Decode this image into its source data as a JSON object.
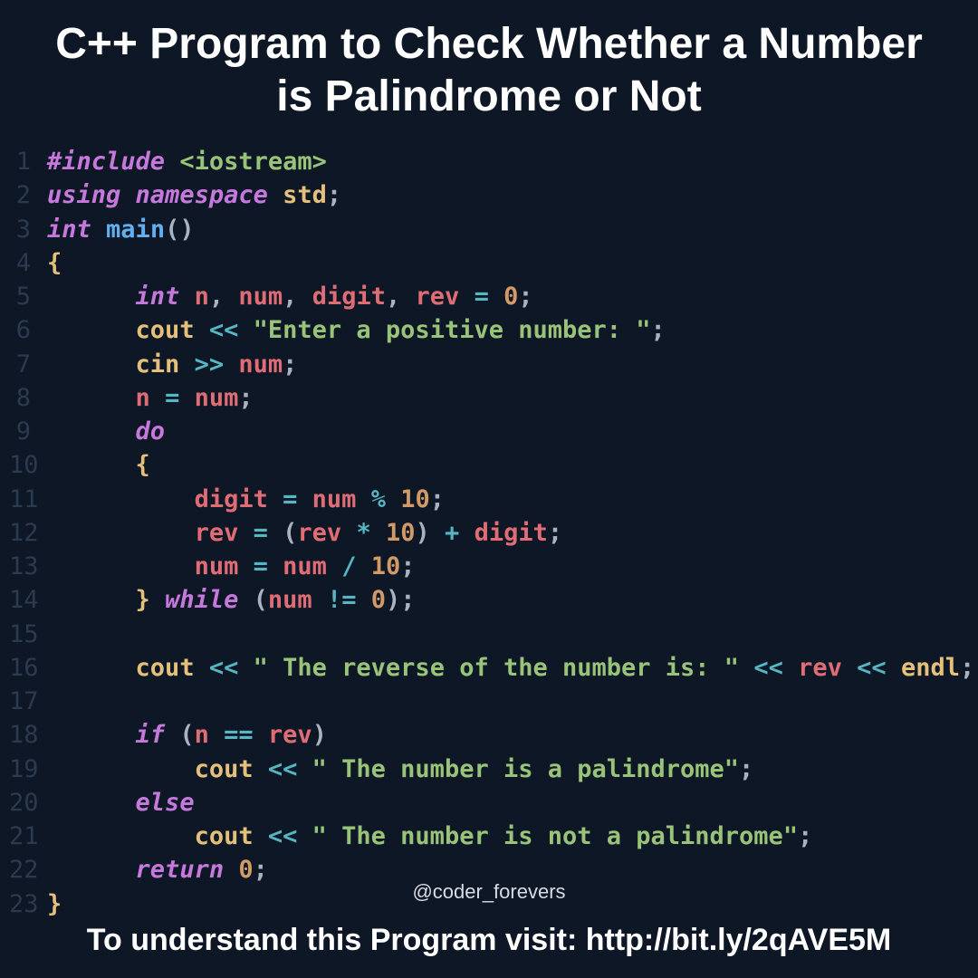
{
  "title": "C++ Program to Check Whether a Number is Palindrome or Not",
  "lines": {
    "l1_pre": "#include",
    "l1_inc": "<iostream>",
    "l2_using": "using",
    "l2_ns": "namespace",
    "l2_std": "std",
    "l3_int": "int",
    "l3_main": "main",
    "l4_brace": "{",
    "l5_int": "int",
    "l5_n": "n",
    "l5_num": "num",
    "l5_digit": "digit",
    "l5_rev": "rev",
    "l5_zero": "0",
    "l6_cout": "cout",
    "l6_str": "\"Enter a positive number: \"",
    "l7_cin": "cin",
    "l7_num": "num",
    "l8_n": "n",
    "l8_num": "num",
    "l9_do": "do",
    "l10_brace": "{",
    "l11_digit": "digit",
    "l11_num": "num",
    "l11_ten": "10",
    "l12_rev": "rev",
    "l12_rev2": "rev",
    "l12_ten": "10",
    "l12_digit": "digit",
    "l13_num": "num",
    "l13_num2": "num",
    "l13_ten": "10",
    "l14_brace": "}",
    "l14_while": "while",
    "l14_num": "num",
    "l14_zero": "0",
    "l16_cout": "cout",
    "l16_str": "\" The reverse of the number is: \"",
    "l16_rev": "rev",
    "l16_endl": "endl",
    "l18_if": "if",
    "l18_n": "n",
    "l18_rev": "rev",
    "l19_cout": "cout",
    "l19_str": "\" The number is a palindrome\"",
    "l20_else": "else",
    "l21_cout": "cout",
    "l21_str": "\" The number is not a palindrome\"",
    "l22_return": "return",
    "l22_zero": "0",
    "l23_brace": "}"
  },
  "linenos": [
    "1",
    "2",
    "3",
    "4",
    "5",
    "6",
    "7",
    "8",
    "9",
    "10",
    "11",
    "12",
    "13",
    "14",
    "15",
    "16",
    "17",
    "18",
    "19",
    "20",
    "21",
    "22",
    "23"
  ],
  "watermark": "@coder_forevers",
  "footer": "To understand this Program visit: http://bit.ly/2qAVE5M"
}
